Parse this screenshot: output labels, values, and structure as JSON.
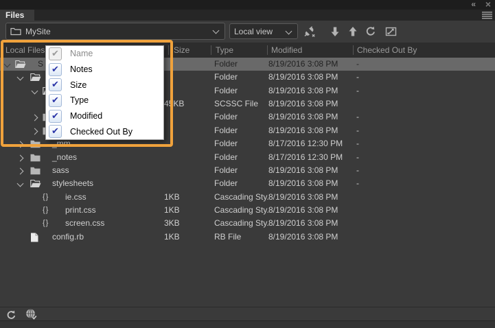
{
  "tab": {
    "label": "Files"
  },
  "window": {
    "collapse_glyph": "«",
    "close_glyph": "×"
  },
  "toolbar": {
    "site_select": {
      "value": "MySite"
    },
    "view_select": {
      "value": "Local view"
    },
    "icons": [
      "connect-to-remote-server",
      "get-files",
      "put-files",
      "refresh",
      "expand-panel"
    ]
  },
  "table": {
    "headers": [
      {
        "key": "name",
        "label": "Local Files"
      },
      {
        "key": "size",
        "label": "Size"
      },
      {
        "key": "type",
        "label": "Type"
      },
      {
        "key": "modified",
        "label": "Modified"
      },
      {
        "key": "checked_out",
        "label": "Checked Out By"
      }
    ]
  },
  "rows": [
    {
      "level": 0,
      "chevron": "expanded",
      "icon": "folder-open",
      "name": "S",
      "size": "",
      "type": "Folder",
      "modified": "8/19/2016 3:08 PM",
      "checked_out": "-",
      "selected": true
    },
    {
      "level": 1,
      "chevron": "expanded",
      "icon": "folder-open",
      "name": "",
      "size": "",
      "type": "Folder",
      "modified": "8/19/2016 3:08 PM",
      "checked_out": "-",
      "selected": false
    },
    {
      "level": 2,
      "chevron": "expanded",
      "icon": "folder-open",
      "name": "",
      "size": "",
      "type": "Folder",
      "modified": "8/19/2016 3:08 PM",
      "checked_out": "-",
      "selected": false
    },
    {
      "level": 3,
      "chevron": null,
      "icon": null,
      "name": "",
      "size": "45KB",
      "type": "SCSSC File",
      "modified": "8/19/2016 3:08 PM",
      "checked_out": "",
      "selected": false
    },
    {
      "level": 2,
      "chevron": "collapsed",
      "icon": "folder",
      "name": "",
      "size": "",
      "type": "Folder",
      "modified": "8/19/2016 3:08 PM",
      "checked_out": "-",
      "selected": false
    },
    {
      "level": 2,
      "chevron": "collapsed",
      "icon": "folder",
      "name": "",
      "size": "",
      "type": "Folder",
      "modified": "8/19/2016 3:08 PM",
      "checked_out": "-",
      "selected": false
    },
    {
      "level": 1,
      "chevron": "collapsed",
      "icon": "folder",
      "name": "_mm",
      "size": "",
      "type": "Folder",
      "modified": "8/17/2016 12:30 PM",
      "checked_out": "-",
      "selected": false
    },
    {
      "level": 1,
      "chevron": "collapsed",
      "icon": "folder",
      "name": "_notes",
      "size": "",
      "type": "Folder",
      "modified": "8/17/2016 12:30 PM",
      "checked_out": "-",
      "selected": false
    },
    {
      "level": 1,
      "chevron": "collapsed",
      "icon": "folder",
      "name": "sass",
      "size": "",
      "type": "Folder",
      "modified": "8/19/2016 3:08 PM",
      "checked_out": "-",
      "selected": false
    },
    {
      "level": 1,
      "chevron": "expanded",
      "icon": "folder-open",
      "name": "stylesheets",
      "size": "",
      "type": "Folder",
      "modified": "8/19/2016 3:08 PM",
      "checked_out": "-",
      "selected": false
    },
    {
      "level": 2,
      "chevron": null,
      "icon": "css",
      "name": "ie.css",
      "size": "1KB",
      "type": "Cascading Sty...",
      "modified": "8/19/2016 3:08 PM",
      "checked_out": "",
      "selected": false
    },
    {
      "level": 2,
      "chevron": null,
      "icon": "css",
      "name": "print.css",
      "size": "1KB",
      "type": "Cascading Sty...",
      "modified": "8/19/2016 3:08 PM",
      "checked_out": "",
      "selected": false
    },
    {
      "level": 2,
      "chevron": null,
      "icon": "css",
      "name": "screen.css",
      "size": "3KB",
      "type": "Cascading Sty...",
      "modified": "8/19/2016 3:08 PM",
      "checked_out": "",
      "selected": false
    },
    {
      "level": 1,
      "chevron": null,
      "icon": "file",
      "name": "config.rb",
      "size": "1KB",
      "type": "RB File",
      "modified": "8/19/2016 3:08 PM",
      "checked_out": "",
      "selected": false
    }
  ],
  "column_menu": {
    "items": [
      {
        "label": "Name",
        "checked": true,
        "disabled": true
      },
      {
        "label": "Notes",
        "checked": true,
        "disabled": false
      },
      {
        "label": "Size",
        "checked": true,
        "disabled": false
      },
      {
        "label": "Type",
        "checked": true,
        "disabled": false
      },
      {
        "label": "Modified",
        "checked": true,
        "disabled": false
      },
      {
        "label": "Checked Out By",
        "checked": true,
        "disabled": false
      }
    ]
  },
  "glyphs": {
    "css_icon": "{}",
    "check": "✔"
  },
  "colors": {
    "annotation_orange": "#F0A23C",
    "selection_gray": "#696969",
    "menu_check_blue": "#2B35A8",
    "panel_background": "#3A3A3A"
  }
}
